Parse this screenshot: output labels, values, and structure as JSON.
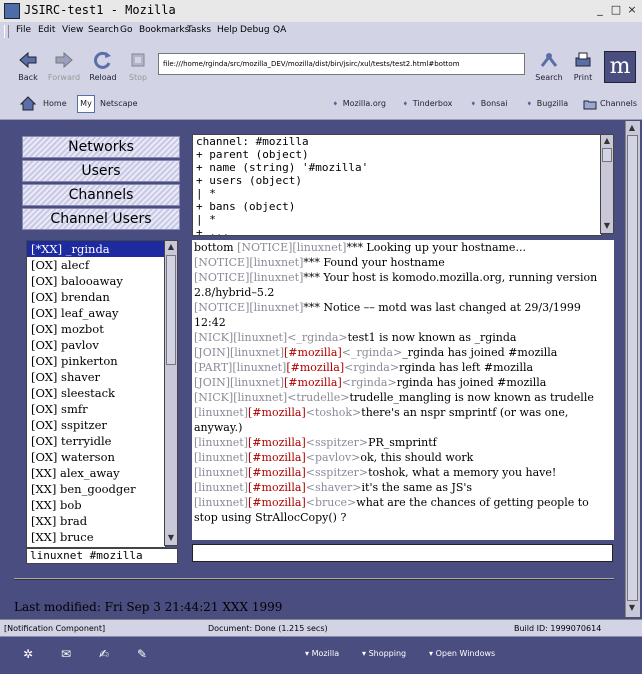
{
  "window": {
    "title": "JSIRC-test1 - Mozilla"
  },
  "menu": [
    "File",
    "Edit",
    "View",
    "Search",
    "Go",
    "Bookmarks",
    "Tasks",
    "Help",
    "Debug",
    "QA"
  ],
  "nav": {
    "back": "Back",
    "forward": "Forward",
    "reload": "Reload",
    "stop": "Stop",
    "url": "file:///home/rginda/src/mozilla_DEV/mozilla/dist/bin/jsirc/xul/tests/test2.html#bottom",
    "search": "Search",
    "print": "Print",
    "logo": "m"
  },
  "personal": {
    "home": "Home",
    "my": "My",
    "netscape": "Netscape",
    "links": [
      "Mozilla.org",
      "Tinderbox",
      "Bonsai",
      "Bugzilla"
    ],
    "channels": "Channels"
  },
  "side_buttons": [
    "Networks",
    "Users",
    "Channels",
    "Channel Users"
  ],
  "users": [
    "[*XX] _rginda",
    "[OX] alecf",
    "[OX] balooaway",
    "[OX] brendan",
    "[OX] leaf_away",
    "[OX] mozbot",
    "[OX] pavlov",
    "[OX] pinkerton",
    "[OX] shaver",
    "[OX] sleestack",
    "[OX] smfr",
    "[OX] sspitzer",
    "[OX] terryidle",
    "[OX] waterson",
    "[XX] alex_away",
    "[XX] ben_goodger",
    "[XX] bob",
    "[XX] brad",
    "[XX] bruce"
  ],
  "channel_label": "linuxnet #mozilla",
  "object_lines": [
    "channel: #mozilla",
    "+ parent (object)",
    "+ name (string) '#mozilla'",
    "+ users (object)",
    "| *",
    "+ bans (object)",
    "| *",
    "+ ..."
  ],
  "messages": [
    {
      "tag": "bottom ",
      "net": "[NOTICE][linuxnet]",
      "chan": "",
      "nick": "",
      "text": "*** Looking up your hostname..."
    },
    {
      "tag": "",
      "net": "[NOTICE][linuxnet]",
      "chan": "",
      "nick": "",
      "text": "*** Found your hostname"
    },
    {
      "tag": "",
      "net": "[NOTICE][linuxnet]",
      "chan": "",
      "nick": "",
      "text": "*** Your host is komodo.mozilla.org, running version 2.8/hybrid–5.2"
    },
    {
      "tag": "",
      "net": "[NOTICE][linuxnet]",
      "chan": "",
      "nick": "",
      "text": "*** Notice –– motd was last changed at 29/3/1999 12:42"
    },
    {
      "tag": "",
      "net": "[NICK][linuxnet]",
      "chan": "",
      "nick": "<_rginda>",
      "text": "test1 is now known as _rginda"
    },
    {
      "tag": "",
      "net": "[JOIN][linuxnet]",
      "chan": "[#mozilla]",
      "nick": "<_rginda>",
      "text": "_rginda has joined #mozilla"
    },
    {
      "tag": "",
      "net": "[PART][linuxnet]",
      "chan": "[#mozilla]",
      "nick": "<rginda>",
      "text": "rginda has left #mozilla"
    },
    {
      "tag": "",
      "net": "[JOIN][linuxnet]",
      "chan": "[#mozilla]",
      "nick": "<rginda>",
      "text": "rginda has joined #mozilla"
    },
    {
      "tag": "",
      "net": "[NICK][linuxnet]",
      "chan": "",
      "nick": "<trudelle>",
      "text": "trudelle_mangling is now known as trudelle"
    },
    {
      "tag": "",
      "net": "[linuxnet]",
      "chan": "[#mozilla]",
      "nick": "<toshok>",
      "text": "there's an nspr smprintf (or was one, anyway.)"
    },
    {
      "tag": "",
      "net": "[linuxnet]",
      "chan": "[#mozilla]",
      "nick": "<sspitzer>",
      "text": "PR_smprintf"
    },
    {
      "tag": "",
      "net": "[linuxnet]",
      "chan": "[#mozilla]",
      "nick": "<pavlov>",
      "text": "ok, this should work"
    },
    {
      "tag": "",
      "net": "[linuxnet]",
      "chan": "[#mozilla]",
      "nick": "<sspitzer>",
      "text": "toshok, what a memory you have!"
    },
    {
      "tag": "",
      "net": "[linuxnet]",
      "chan": "[#mozilla]",
      "nick": "<shaver>",
      "text": "it's the same as JS's"
    },
    {
      "tag": "",
      "net": "[linuxnet]",
      "chan": "[#mozilla]",
      "nick": "<bruce>",
      "text": "what are the chances of getting people to stop using StrAllocCopy() ?"
    }
  ],
  "last_modified": "Last modified: Fri Sep 3 21:44:21 XXX 1999",
  "status": {
    "left": "[Notification Component]",
    "middle": "Document: Done (1.215 secs)",
    "right": "Build ID: 1999070614"
  },
  "taskbar": {
    "items": [
      "Mozilla",
      "Shopping",
      "Open Windows"
    ]
  }
}
